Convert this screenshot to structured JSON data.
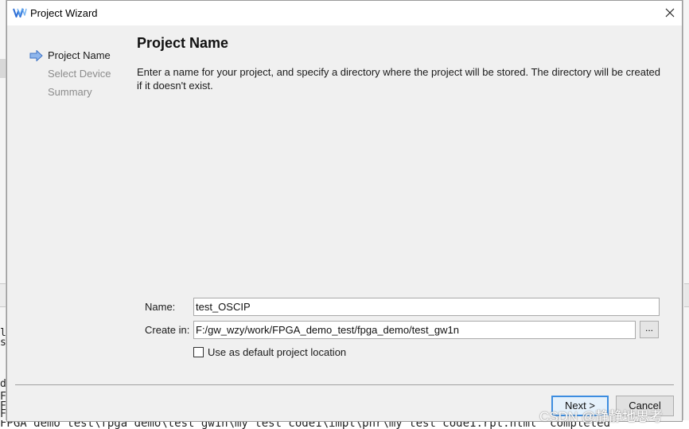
{
  "background": {
    "left_fragments": [
      "d",
      "F",
      "F",
      "F"
    ],
    "left_mid_fragments": [
      "l",
      "s"
    ],
    "bottom_log": "FPGA_demo_test\\fpga_demo\\test_gw1n\\my_test_code1\\impl\\pnr\\my_test_code1.rpt.html\" completed"
  },
  "dialog": {
    "title": "Project Wizard",
    "app_icon": "gowin-logo-icon",
    "close_icon": "close-icon"
  },
  "steps": [
    {
      "label": "Project Name",
      "state": "active"
    },
    {
      "label": "Select Device",
      "state": "inactive"
    },
    {
      "label": "Summary",
      "state": "inactive"
    }
  ],
  "page": {
    "title": "Project Name",
    "description": "Enter a name for your project, and specify a directory where the project will be stored. The directory will be created if it doesn't exist."
  },
  "form": {
    "name_label": "Name:",
    "name_value": "test_OSCIP",
    "create_in_label": "Create in:",
    "create_in_value": "F:/gw_wzy/work/FPGA_demo_test/fpga_demo/test_gw1n",
    "browse_label": "...",
    "default_location_label": "Use as default project location",
    "default_location_checked": false
  },
  "buttons": {
    "next": "Next >",
    "cancel": "Cancel"
  },
  "watermark": "CSDN @静静地思考",
  "colors": {
    "dialog_bg": "#f0f0f0",
    "step_arrow": "#4a7fd0",
    "primary_border": "#3c8de0"
  }
}
